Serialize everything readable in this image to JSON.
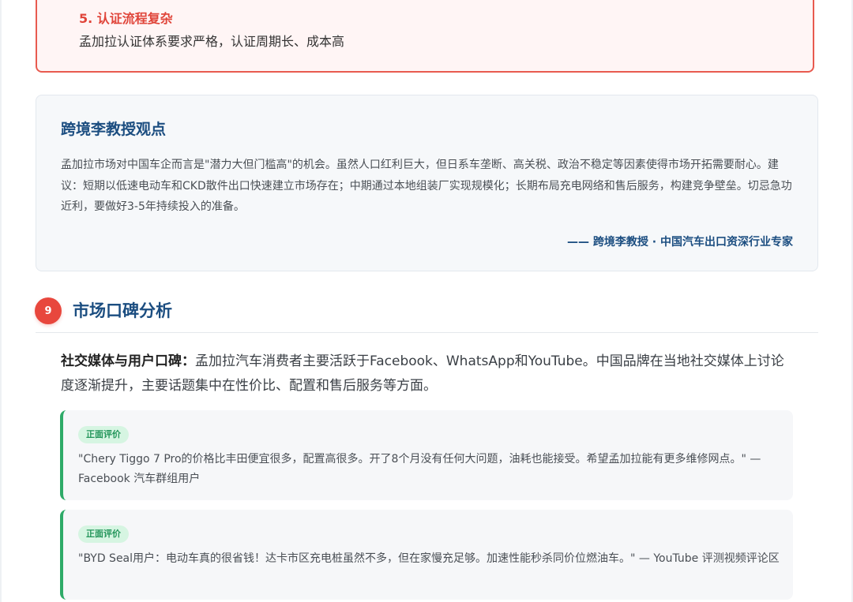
{
  "risk": {
    "title": "5. 认证流程复杂",
    "description": "孟加拉认证体系要求严格，认证周期长、成本高"
  },
  "expert": {
    "title": "跨境李教授观点",
    "body": "孟加拉市场对中国车企而言是\"潜力大但门槛高\"的机会。虽然人口红利巨大，但日系车垄断、高关税、政治不稳定等因素使得市场开拓需要耐心。建议：短期以低速电动车和CKD散件出口快速建立市场存在；中期通过本地组装厂实现规模化；长期布局充电网络和售后服务，构建竞争壁垒。切忌急功近利，要做好3-5年持续投入的准备。",
    "signature": "—— 跨境李教授 · 中国汽车出口资深行业专家"
  },
  "section": {
    "number": "9",
    "title": "市场口碑分析",
    "intro_lead": "社交媒体与用户口碑：",
    "intro_text": "孟加拉汽车消费者主要活跃于Facebook、WhatsApp和YouTube。中国品牌在当地社交媒体上讨论度逐渐提升，主要话题集中在性价比、配置和售后服务等方面。"
  },
  "reviews": [
    {
      "badge": "正面评价",
      "text": "\"Chery Tiggo 7 Pro的价格比丰田便宜很多，配置高很多。开了8个月没有任何大问题，油耗也能接受。希望孟加拉能有更多维修网点。\" — Facebook 汽车群组用户"
    },
    {
      "badge": "正面评价",
      "text": "\"BYD Seal用户：电动车真的很省钱！达卡市区充电桩虽然不多，但在家慢充足够。加速性能秒杀同价位燃油车。\" — YouTube 评测视频评论区"
    }
  ],
  "colors": {
    "accent_red": "#e8473d",
    "heading_blue": "#1b4d80",
    "positive_green": "#2eaa68",
    "risk_bg": "#fff5f5"
  }
}
